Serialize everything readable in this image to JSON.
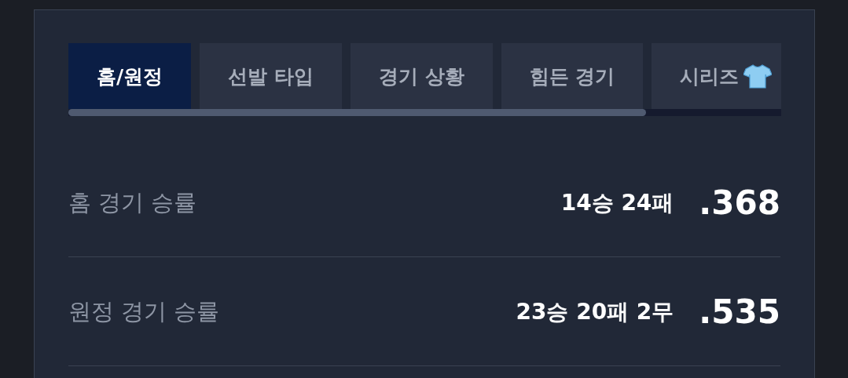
{
  "tabs": [
    {
      "label": "홈/원정",
      "selected": true,
      "icon": false
    },
    {
      "label": "선발 타입",
      "selected": false,
      "icon": false
    },
    {
      "label": "경기 상황",
      "selected": false,
      "icon": false
    },
    {
      "label": "힘든 경기",
      "selected": false,
      "icon": false
    },
    {
      "label": "시리즈",
      "selected": false,
      "icon": true
    }
  ],
  "rows": [
    {
      "label": "홈 경기 승률",
      "record": "14승 24패",
      "rate": ".368"
    },
    {
      "label": "원정 경기 승률",
      "record": "23승 20패 2무",
      "rate": ".535"
    }
  ]
}
